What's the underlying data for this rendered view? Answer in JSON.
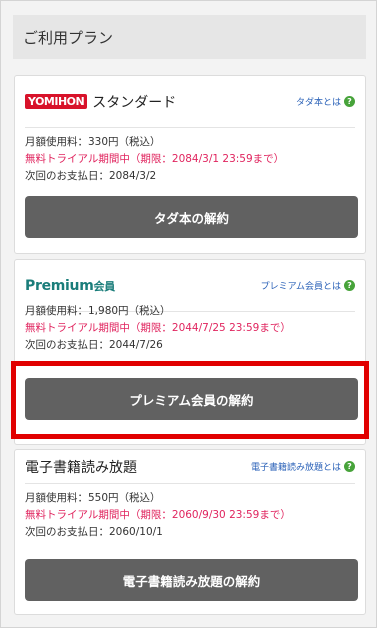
{
  "section": {
    "title": "ご利用プラン"
  },
  "cards": [
    {
      "logo": "YOMIHON",
      "name": "スタンダード",
      "help": "タダ本とは",
      "fee": "月額使用料：330円（税込）",
      "trial": "無料トライアル期間中（期限：2084/3/1 23:59まで）",
      "next": "次回のお支払日：2084/3/2",
      "button": "タダ本の解約"
    },
    {
      "logo": "Premium",
      "logo_suffix": "会員",
      "name": "",
      "help": "プレミアム会員とは",
      "fee": "月額使用料：1,980円（税込）",
      "trial": "無料トライアル期間中（期限：2044/7/25 23:59まで）",
      "next": "次回のお支払日：2044/7/26",
      "button": "プレミアム会員の解約"
    },
    {
      "name": "電子書籍読み放題",
      "help": "電子書籍読み放題とは",
      "fee": "月額使用料：550円（税込）",
      "trial": "無料トライアル期間中（期限：2060/9/30 23:59まで）",
      "next": "次回のお支払日：2060/10/1",
      "button": "電子書籍読み放題の解約"
    }
  ],
  "colors": {
    "trial_text": "#e0245e",
    "button_bg": "#616161",
    "highlight": "#e10000",
    "help_link": "#2b62b8"
  }
}
